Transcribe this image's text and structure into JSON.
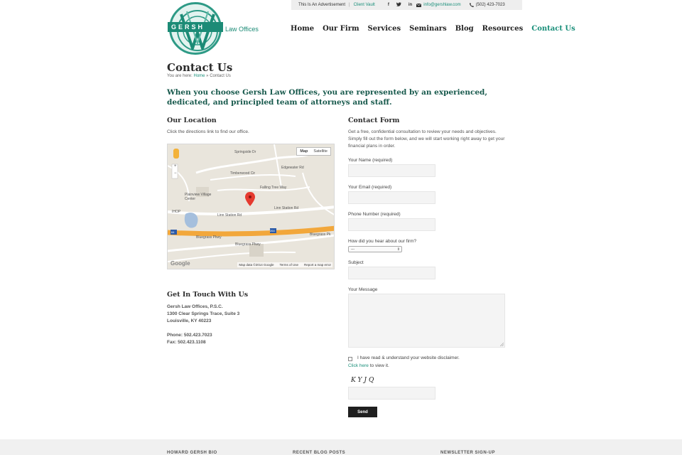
{
  "topbar": {
    "advertisement": "This Is An Advertisement",
    "separator": "|",
    "client_vault": "Client Vault",
    "social": [
      {
        "icon": "facebook-icon",
        "glyph": "f"
      },
      {
        "icon": "twitter-icon",
        "glyph": "t"
      },
      {
        "icon": "linkedin-icon",
        "glyph": "in"
      }
    ],
    "email": "info@gershlaw.com",
    "phone": "(502) 423-7023"
  },
  "logo": {
    "band_text": "GERSH",
    "text": "Law Offices",
    "brand_color": "#1c8b76"
  },
  "nav": {
    "items": [
      "Home",
      "Our Firm",
      "Services",
      "Seminars",
      "Blog",
      "Resources",
      "Contact Us"
    ],
    "active": "Contact Us"
  },
  "page": {
    "title": "Contact Us",
    "breadcrumb_prefix": "You are here:",
    "breadcrumb_home": "Home",
    "breadcrumb_sep": "»",
    "breadcrumb_current": "Contact Us",
    "intro": "When you choose Gersh Law Offices, you are represented by an experienced, dedicated, and principled team of attorneys and staff."
  },
  "location": {
    "heading": "Our Location",
    "subtext": "Click the directions link to find our office.",
    "map": {
      "toggle_map": "Map",
      "toggle_satellite": "Satellite",
      "labels": [
        "Timberwood Cir",
        "Plainview Village Center",
        "Linn Station Rd",
        "Bluegrass Pkwy",
        "Bluegrass Pk",
        "Falling Tree Way",
        "Springside Dr",
        "Edgewater Rd",
        "IHOP"
      ],
      "shields": [
        "64",
        "264"
      ],
      "google": "Google",
      "footer_data": "Map data ©2014 Google",
      "footer_terms": "Terms of Use",
      "footer_report": "Report a map error"
    }
  },
  "touch": {
    "heading": "Get In Touch With Us",
    "line1": "Gersh Law Offices, P.S.C.",
    "line2": "1300 Clear Springs Trace, Suite 3",
    "line3": "Louisville, KY 40223",
    "phone": "Phone: 502.423.7023",
    "fax": "Fax: 502.423.1108"
  },
  "form": {
    "heading": "Contact Form",
    "description": "Get a free, confidential consultation to review your needs and objectives. Simply fill out the form below, and we will start working right away to get your financial plans in order.",
    "name_label": "Your Name (required)",
    "email_label": "Your Email (required)",
    "phone_label": "Phone Number (required)",
    "hear_label": "How did you hear about our firm?",
    "hear_selected": "---",
    "subject_label": "Subject",
    "message_label": "Your Message",
    "disclaimer": "I have read & understand your website disclaimer.",
    "click_here": "Click here",
    "view_it": "to view it.",
    "captcha": "KYJQ",
    "send": "Send"
  },
  "footer": {
    "col1": "HOWARD GERSH BIO",
    "col2": "RECENT BLOG POSTS",
    "col3": "NEWSLETTER SIGN-UP"
  }
}
